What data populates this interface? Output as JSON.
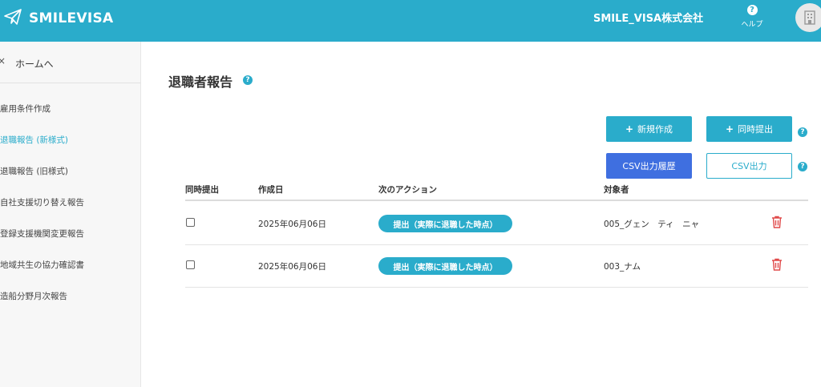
{
  "header": {
    "app_name": "SMILEVISA",
    "company_name": "SMILE_VISA株式会社",
    "help_label": "ヘルプ",
    "help_icon": "question-icon",
    "brand_color": "#2aaccb"
  },
  "sidebar": {
    "home_label": "ホームへ",
    "items": [
      {
        "label": "雇用条件作成",
        "active": false
      },
      {
        "label": "退職報告 (新様式)",
        "active": true
      },
      {
        "label": "退職報告 (旧様式)",
        "active": false
      },
      {
        "label": "自社支援切り替え報告",
        "active": false
      },
      {
        "label": "登録支援機関変更報告",
        "active": false
      },
      {
        "label": "地域共生の協力確認書",
        "active": false
      },
      {
        "label": "造船分野月次報告",
        "active": false
      }
    ]
  },
  "main": {
    "title": "退職者報告",
    "buttons": {
      "new": "新規作成",
      "bulk_submit": "同時提出",
      "csv_history": "CSV出力履歴",
      "csv_export": "CSV出力"
    },
    "table": {
      "headers": [
        "同時提出",
        "作成日",
        "次のアクション",
        "対象者"
      ],
      "rows": [
        {
          "checked": false,
          "created": "2025年06月06日",
          "action": "提出（実際に退職した時点）",
          "person": "005_グェン　ティ　ニャ"
        },
        {
          "checked": false,
          "created": "2025年06月06日",
          "action": "提出（実際に退職した時点）",
          "person": "003_ナム"
        }
      ]
    }
  }
}
